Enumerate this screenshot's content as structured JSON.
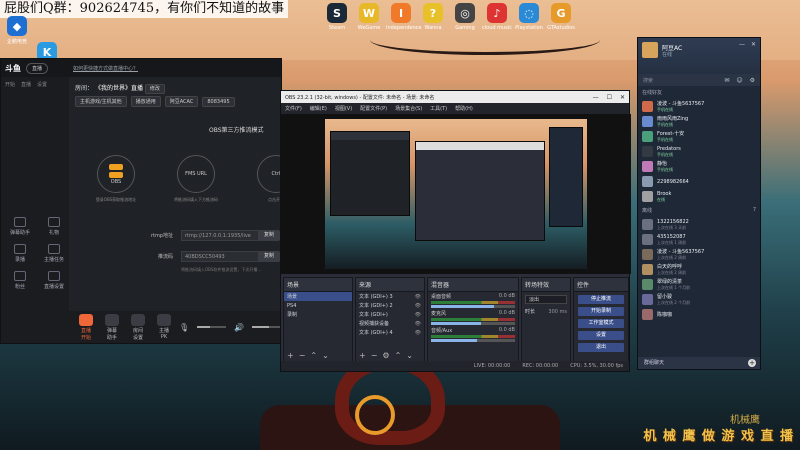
{
  "banner": {
    "text": "屁股们Q群：902624745，有你们不知道的故事"
  },
  "desktop_icons": [
    {
      "label": "Steam",
      "glyph": "S",
      "color": "#1b2838"
    },
    {
      "label": "WeGame",
      "glyph": "W",
      "color": "#e7b928"
    },
    {
      "label": "Independence",
      "glyph": "I",
      "color": "#f07a2a"
    },
    {
      "label": "Wanna",
      "glyph": "?",
      "color": "#e8c12a"
    },
    {
      "label": "Gaming",
      "glyph": "◎",
      "color": "#444"
    },
    {
      "label": "cloud music",
      "glyph": "♪",
      "color": "#d33"
    },
    {
      "label": "Playstation",
      "glyph": "◌",
      "color": "#2a8ad6"
    },
    {
      "label": "GTAstudios",
      "glyph": "G",
      "color": "#e59a2a"
    }
  ],
  "desktop_left_icons": [
    {
      "label": "企鹅电竞",
      "glyph": "◆",
      "color": "#1d6fd1"
    },
    {
      "label": "快手",
      "glyph": "K",
      "color": "#2a9ae2"
    }
  ],
  "stream_app": {
    "brand": "斗鱼",
    "version": "直播",
    "notice": "如何更快捷方式做直播中心？",
    "tabs": [
      "开始",
      "直播",
      "设置"
    ],
    "room_title_label": "房间：",
    "room_title": "《我的世界》直播",
    "edit_label": "修改",
    "chips": [
      "主机游戏/主机其他",
      "播放通用",
      "阿豆ACAC",
      "8083495"
    ],
    "mode_title": "OBS第三方推流模式",
    "nodes": [
      {
        "label": "OBS",
        "caption": "登录OBS获取推流地址"
      },
      {
        "label": "FMS URL",
        "caption": "将推流码填入下方推流码"
      },
      {
        "label": "Ctrl",
        "caption": "点击开播"
      }
    ],
    "rtmp_label": "rtmp地址",
    "rtmp_value": "rtmp://127.0.0.1:1935/live",
    "key_label": "推流码",
    "key_value": "40BDSCC50493",
    "copy_label": "复制",
    "help_text": "将推流码填入OBS软件推流设置，下次开播…",
    "tools": [
      {
        "label": "弹幕助手"
      },
      {
        "label": "礼物"
      },
      {
        "label": "录播"
      },
      {
        "label": "主播任务"
      },
      {
        "label": "粉丝"
      },
      {
        "label": "直播设置"
      }
    ],
    "bottom_buttons": [
      {
        "label": "直播开始",
        "accent": true
      },
      {
        "label": "弹幕助手"
      },
      {
        "label": "房间设置"
      },
      {
        "label": "主播PK"
      }
    ],
    "mic_level": 0.45,
    "speaker_level": 0.6
  },
  "obs": {
    "title": "OBS 23.2.1 (32-bit, windows) - 配置文件: 未命名 - 场景: 未命名",
    "menu": [
      "文件(F)",
      "编辑(E)",
      "视图(V)",
      "配置文件(P)",
      "场景集合(S)",
      "工具(T)",
      "帮助(H)"
    ],
    "docks": {
      "scenes": {
        "title": "场景",
        "items": [
          "场景",
          "PS4",
          "录制"
        ]
      },
      "sources": {
        "title": "来源",
        "items": [
          "文本 (GDI+) 3",
          "文本 (GDI+) 2",
          "文本 (GDI+)",
          "视频捕获设备",
          "文本 (GDI+) 4"
        ]
      },
      "mixer": {
        "title": "混音器",
        "channels": [
          {
            "name": "桌面音频",
            "db": "0.0 dB",
            "level": 0.75
          },
          {
            "name": "麦克风",
            "db": "0.0 dB",
            "level": 0.6
          },
          {
            "name": "音频/Aux",
            "db": "0.0 dB",
            "level": 0.55
          }
        ]
      },
      "transitions": {
        "title": "转场特效",
        "selected": "淡出",
        "duration_label": "时长",
        "duration_value": "300 ms"
      },
      "controls": {
        "title": "控件",
        "buttons": [
          "停止推流",
          "开始录制",
          "工作室模式",
          "设置",
          "退出"
        ]
      }
    },
    "status": {
      "live": "LIVE: 00:00:00",
      "rec": "REC: 00:00:00",
      "cpu": "CPU: 3.5%, 30.00 fps"
    }
  },
  "qq": {
    "name": "阿豆AC",
    "status": "在线",
    "search_placeholder": "搜索",
    "groups": [
      {
        "title": "在线好友",
        "count": ""
      },
      {
        "title": "离线",
        "count": "7"
      }
    ],
    "friends": [
      {
        "name": "凌波 - 斗鱼5637567",
        "status": "手机在线",
        "color": "#d06a4a",
        "online": true
      },
      {
        "name": "雨雨风雨Zing",
        "status": "手机在线",
        "color": "#6a8ad0",
        "online": true
      },
      {
        "name": "Forest-十安",
        "status": "手机在线",
        "color": "#4aa07a",
        "online": true
      },
      {
        "name": "Predators",
        "status": "手机在线",
        "color": "#333a44",
        "online": true
      },
      {
        "name": "静怡",
        "status": "手机在线",
        "color": "#c07ab8",
        "online": true
      },
      {
        "name": "2298982664",
        "status": "",
        "color": "#8a9ab0",
        "online": true
      },
      {
        "name": "Brook",
        "status": "在线",
        "color": "#a0a0a0",
        "online": true
      }
    ],
    "offline_friends": [
      {
        "name": "1322156822",
        "status": "上次在线 3 天前",
        "color": "#6a7080"
      },
      {
        "name": "435152087",
        "status": "上次在线 1 周前",
        "color": "#6a7080"
      },
      {
        "name": "凌波 - 斗鱼5637567",
        "status": "上次在线 2 周前",
        "color": "#7a6a5a"
      },
      {
        "name": "白天的呼呼",
        "status": "上次在线 2 周前",
        "color": "#b09060"
      },
      {
        "name": "翠绿的清茶",
        "status": "上次在线 1 个月前",
        "color": "#5a8a6a"
      },
      {
        "name": "留小骏",
        "status": "上次在线 2 个月前",
        "color": "#6a6a9a"
      },
      {
        "name": "陈咖咖",
        "status": "",
        "color": "#9a6a6a"
      }
    ],
    "footer": "群组聊天"
  },
  "watermark": {
    "line1": "机械鹰",
    "line2": "机 械 鹰 做 游 戏 直 播"
  }
}
